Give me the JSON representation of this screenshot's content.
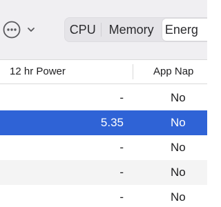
{
  "toolbar": {
    "more_icon": "ellipsis-circle-icon",
    "chevron_icon": "chevron-down-icon",
    "tabs": [
      {
        "label": "CPU"
      },
      {
        "label": "Memory"
      },
      {
        "label": "Energ"
      }
    ],
    "selected_tab": "Energ"
  },
  "table": {
    "columns": [
      "12 hr Power",
      "App Nap"
    ],
    "rows": [
      {
        "power": "-",
        "app_nap": "No",
        "selected": false
      },
      {
        "power": "5.35",
        "app_nap": "No",
        "selected": true
      },
      {
        "power": "-",
        "app_nap": "No",
        "selected": false
      },
      {
        "power": "-",
        "app_nap": "No",
        "selected": false
      },
      {
        "power": "-",
        "app_nap": "No",
        "selected": false
      }
    ]
  },
  "colors": {
    "selection": "#2f63d6",
    "toolbar_bg": "#f0eff2",
    "alt_row": "#f4f4f4"
  }
}
